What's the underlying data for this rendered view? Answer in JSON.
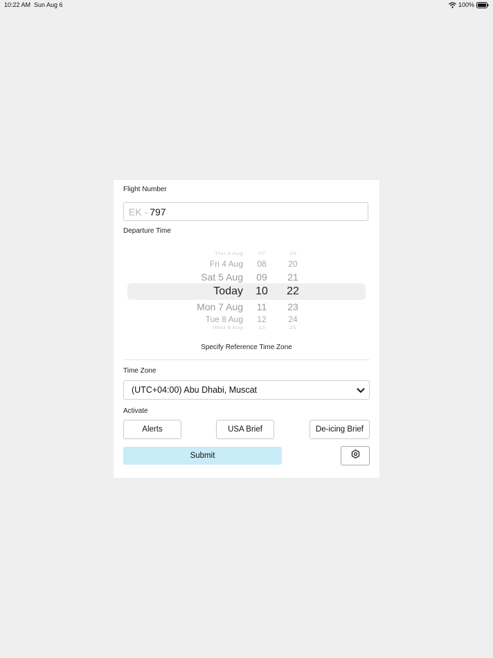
{
  "status_bar": {
    "time": "10:22 AM",
    "date": "Sun Aug 6",
    "battery": "100%",
    "icons": [
      "wifi-icon",
      "battery-icon"
    ]
  },
  "form": {
    "flight_number_label": "Flight Number",
    "flight_prefix": "EK -",
    "flight_number_value": "797",
    "departure_time_label": "Departure Time",
    "picker": {
      "dates": [
        "Thu 3 Aug",
        "Fri 4 Aug",
        "Sat 5 Aug",
        "Today",
        "Mon 7 Aug",
        "Tue 8 Aug",
        "Wed 9 Aug"
      ],
      "hours": [
        "07",
        "08",
        "09",
        "10",
        "11",
        "12",
        "13"
      ],
      "minutes": [
        "19",
        "20",
        "21",
        "22",
        "23",
        "24",
        "25"
      ],
      "selected": {
        "date": "Today",
        "hour": "10",
        "minute": "22"
      }
    },
    "reference_tz_link": "Specify Reference Time Zone",
    "time_zone_label": "Time Zone",
    "time_zone_value": "(UTC+04:00) Abu Dhabi, Muscat",
    "activate_label": "Activate",
    "buttons": {
      "alerts": "Alerts",
      "usa_brief": "USA Brief",
      "deicing_brief": "De-icing Brief",
      "submit": "Submit"
    },
    "colors": {
      "submit_bg": "#c8ecf8",
      "picker_highlight": "#efefef",
      "page_bg": "#efefef"
    },
    "settings_icon": "gear-icon"
  }
}
